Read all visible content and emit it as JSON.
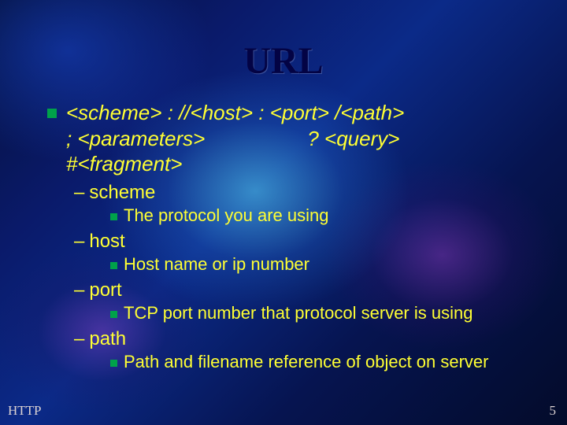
{
  "title": "URL",
  "template_lines": [
    "<scheme> : //<host> : <port> /<path>",
    "; <parameters>                  ? <query>",
    "#<fragment>"
  ],
  "items": [
    {
      "term": "scheme",
      "desc": "The protocol you are using"
    },
    {
      "term": "host",
      "desc": "Host name or ip number"
    },
    {
      "term": "port",
      "desc": "TCP port number that protocol server is using"
    },
    {
      "term": "path",
      "desc": "Path and filename reference of object on server"
    }
  ],
  "footer": {
    "left": "HTTP",
    "page": "5"
  }
}
